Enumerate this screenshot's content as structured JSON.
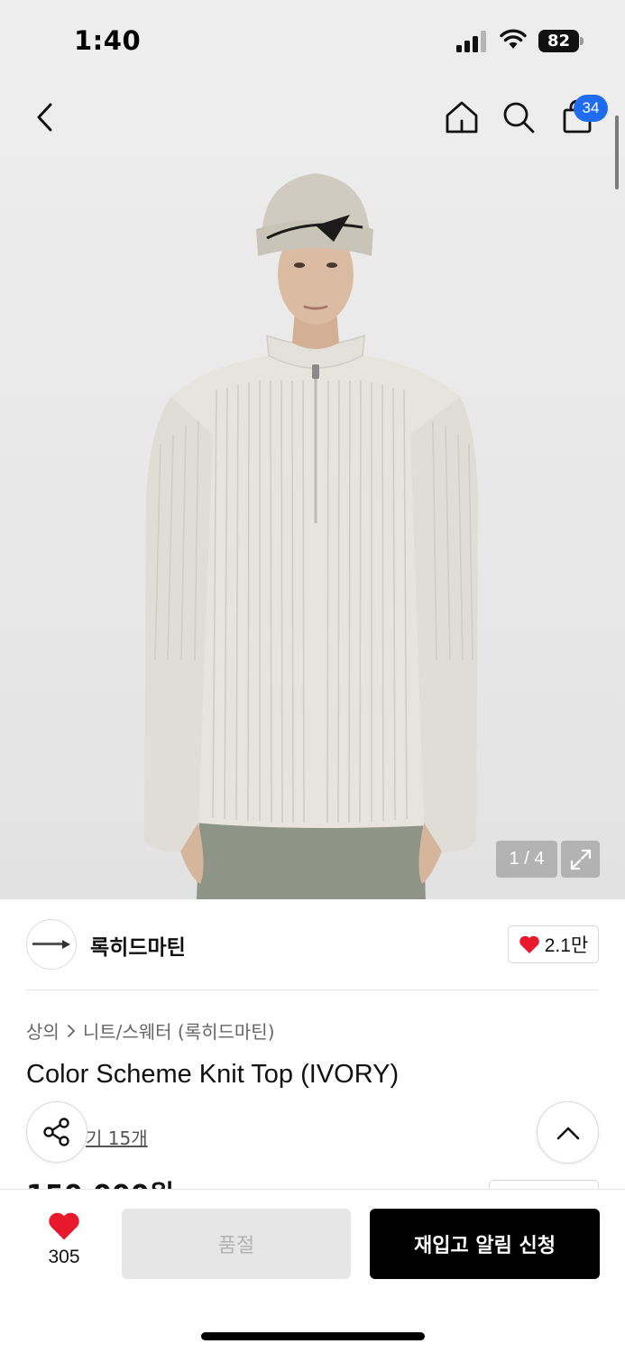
{
  "status_bar": {
    "time": "1:40",
    "battery": "82"
  },
  "nav": {
    "cart_count": "34"
  },
  "gallery": {
    "counter": "1 / 4"
  },
  "brand": {
    "name": "록히드마틴",
    "likes": "2.1만"
  },
  "breadcrumb": {
    "category": "상의",
    "subcategory": "니트/스웨터 (록히드마틴)"
  },
  "product": {
    "title": "Color Scheme Knit Top (IVORY)",
    "review_link": "기 15개",
    "price_partial": "150,000원"
  },
  "actions": {
    "wishlist_count": "305",
    "soldout_label": "품절",
    "restock_label": "재입고 알림 신청"
  },
  "colors": {
    "accent_blue": "#1f6cf0",
    "heart_red": "#e8192c",
    "primary_black": "#000000"
  }
}
